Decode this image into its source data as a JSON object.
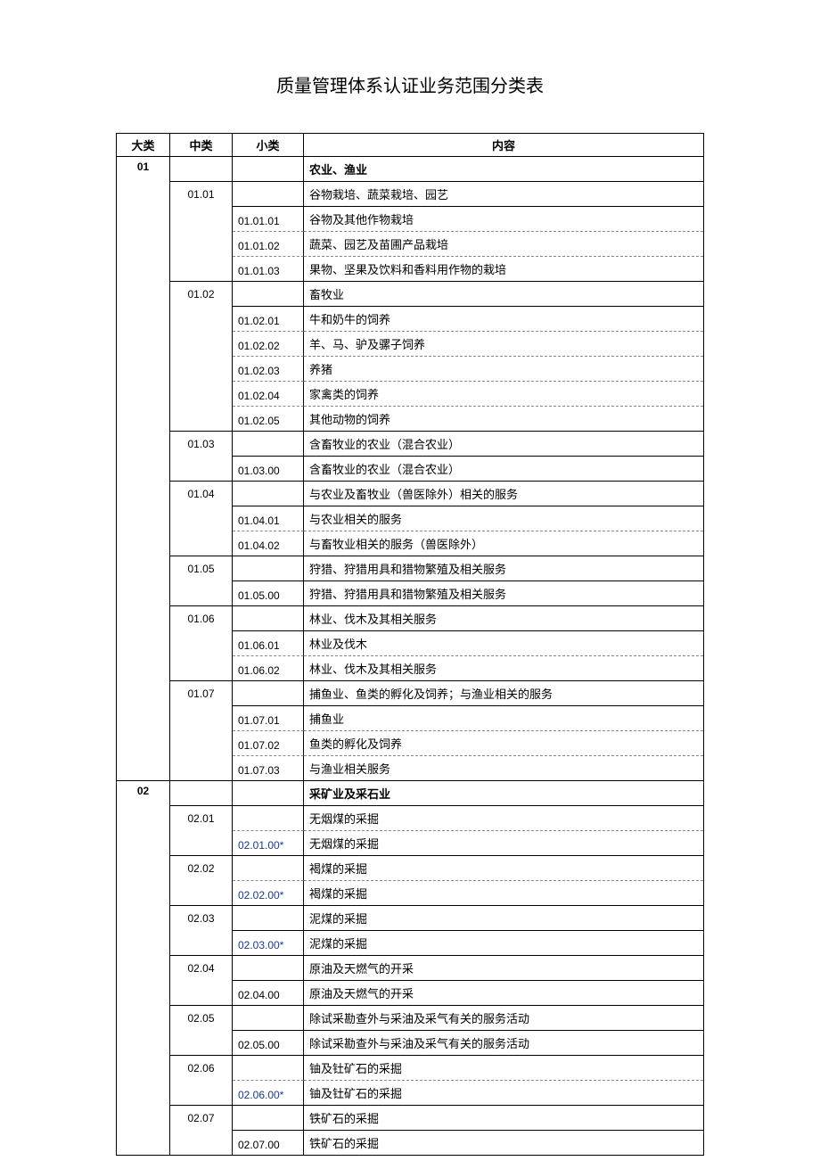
{
  "title": "质量管理体系认证业务范围分类表",
  "headers": {
    "major": "大类",
    "mid": "中类",
    "sub": "小类",
    "content": "内容"
  },
  "rows": [
    {
      "major": "01",
      "mid": "",
      "sub": "",
      "content": "农业、渔业",
      "majorLines": 30,
      "midLines": 1,
      "contentBold": true,
      "bbMajor": "",
      "bbMid": "solid",
      "bbSub": "solid",
      "bbContent": "solid",
      "contentDashAbove": false
    },
    {
      "major": "",
      "mid": "01.01",
      "sub": "",
      "content": "谷物栽培、蔬菜栽培、园艺",
      "midLines": 4,
      "bbMid": "",
      "bbSub": "solid",
      "bbContent": "solid"
    },
    {
      "major": "",
      "mid": "",
      "sub": "01.01.01",
      "content": "谷物及其他作物栽培",
      "bbSub": "dash",
      "bbContent": "dash"
    },
    {
      "major": "",
      "mid": "",
      "sub": "01.01.02",
      "content": "蔬菜、园艺及苗圃产品栽培",
      "bbSub": "dash",
      "bbContent": "dash"
    },
    {
      "major": "",
      "mid": "",
      "sub": "01.01.03",
      "content": "果物、坚果及饮料和香料用作物的栽培",
      "bbMid": "solid",
      "bbSub": "solid",
      "bbContent": "solid",
      "midBottomSolid": true
    },
    {
      "major": "",
      "mid": "01.02",
      "sub": "",
      "content": "畜牧业",
      "midLines": 6,
      "bbMid": "",
      "bbSub": "solid",
      "bbContent": "solid"
    },
    {
      "major": "",
      "mid": "",
      "sub": "01.02.01",
      "content": "牛和奶牛的饲养",
      "bbSub": "dash",
      "bbContent": "dash"
    },
    {
      "major": "",
      "mid": "",
      "sub": "01.02.02",
      "content": "羊、马、驴及骡子饲养",
      "bbSub": "dash",
      "bbContent": "dash"
    },
    {
      "major": "",
      "mid": "",
      "sub": "01.02.03",
      "content": "养猪",
      "bbSub": "dash",
      "bbContent": "dash"
    },
    {
      "major": "",
      "mid": "",
      "sub": "01.02.04",
      "content": "家禽类的饲养",
      "bbSub": "dash",
      "bbContent": "dash"
    },
    {
      "major": "",
      "mid": "",
      "sub": "01.02.05",
      "content": "其他动物的饲养",
      "bbMid": "solid",
      "bbSub": "solid",
      "bbContent": "solid",
      "midBottomSolid": true
    },
    {
      "major": "",
      "mid": "01.03",
      "sub": "",
      "content": "含畜牧业的农业（混合农业）",
      "midLines": 2,
      "bbMid": "",
      "bbSub": "solid",
      "bbContent": "solid"
    },
    {
      "major": "",
      "mid": "",
      "sub": "01.03.00",
      "content": "含畜牧业的农业（混合农业）",
      "bbMid": "solid",
      "bbSub": "solid",
      "bbContent": "solid",
      "midBottomSolid": true
    },
    {
      "major": "",
      "mid": "01.04",
      "sub": "",
      "content": "与农业及畜牧业（兽医除外）相关的服务",
      "midLines": 3,
      "bbMid": "",
      "bbSub": "solid",
      "bbContent": "solid"
    },
    {
      "major": "",
      "mid": "",
      "sub": "01.04.01",
      "content": "与农业相关的服务",
      "bbSub": "dash",
      "bbContent": "dash"
    },
    {
      "major": "",
      "mid": "",
      "sub": "01.04.02",
      "content": "与畜牧业相关的服务（兽医除外）",
      "bbMid": "solid",
      "bbSub": "solid",
      "bbContent": "solid",
      "midBottomSolid": true
    },
    {
      "major": "",
      "mid": "01.05",
      "sub": "",
      "content": "狩猎、狩猎用具和猎物繁殖及相关服务",
      "midLines": 2,
      "bbMid": "",
      "bbSub": "solid",
      "bbContent": "solid"
    },
    {
      "major": "",
      "mid": "",
      "sub": "01.05.00",
      "content": "狩猎、狩猎用具和猎物繁殖及相关服务",
      "bbMid": "solid",
      "bbSub": "solid",
      "bbContent": "solid",
      "midBottomSolid": true
    },
    {
      "major": "",
      "mid": "01.06",
      "sub": "",
      "content": "林业、伐木及其相关服务",
      "midLines": 3,
      "bbMid": "",
      "bbSub": "solid",
      "bbContent": "solid"
    },
    {
      "major": "",
      "mid": "",
      "sub": "01.06.01",
      "content": "林业及伐木",
      "bbSub": "dash",
      "bbContent": "dash"
    },
    {
      "major": "",
      "mid": "",
      "sub": "01.06.02",
      "content": "林业、伐木及其相关服务",
      "bbMid": "solid",
      "bbSub": "solid",
      "bbContent": "solid",
      "midBottomSolid": true
    },
    {
      "major": "",
      "mid": "01.07",
      "sub": "",
      "content": "捕鱼业、鱼类的孵化及饲养；与渔业相关的服务",
      "midLines": 4,
      "bbMid": "",
      "bbSub": "solid",
      "bbContent": "solid"
    },
    {
      "major": "",
      "mid": "",
      "sub": "01.07.01",
      "content": "捕鱼业",
      "bbSub": "dash",
      "bbContent": "dash"
    },
    {
      "major": "",
      "mid": "",
      "sub": "01.07.02",
      "content": "鱼类的孵化及饲养",
      "bbSub": "dash",
      "bbContent": "dash"
    },
    {
      "major": "",
      "mid": "",
      "sub": "01.07.03",
      "content": "与渔业相关服务",
      "bbMid": "solid",
      "bbSub": "solid",
      "bbContent": "solid",
      "midBottomSolid": true,
      "majorBottomSolid": true
    },
    {
      "major": "02",
      "mid": "",
      "sub": "",
      "content": "采矿业及采石业",
      "majorLines": 15,
      "midLines": 1,
      "contentBold": true,
      "bbMid": "solid",
      "bbSub": "solid",
      "bbContent": "solid"
    },
    {
      "major": "",
      "mid": "02.01",
      "sub": "",
      "content": "无烟煤的采掘",
      "midLines": 2,
      "bbMid": "",
      "bbSub": "dash",
      "bbContent": "dash"
    },
    {
      "major": "",
      "mid": "",
      "sub": "02.01.00*",
      "content": "无烟煤的采掘",
      "subStar": true,
      "bbMid": "solid",
      "bbSub": "solid",
      "bbContent": "solid",
      "midBottomSolid": true
    },
    {
      "major": "",
      "mid": "02.02",
      "sub": "",
      "content": "褐煤的采掘",
      "midLines": 2,
      "bbMid": "",
      "bbSub": "dash",
      "bbContent": "dash"
    },
    {
      "major": "",
      "mid": "",
      "sub": "02.02.00*",
      "content": "褐煤的采掘",
      "subStar": true,
      "bbMid": "solid",
      "bbSub": "solid",
      "bbContent": "solid",
      "midBottomSolid": true
    },
    {
      "major": "",
      "mid": "02.03",
      "sub": "",
      "content": "泥煤的采掘",
      "midLines": 2,
      "bbMid": "",
      "bbSub": "solid",
      "bbContent": "solid"
    },
    {
      "major": "",
      "mid": "",
      "sub": "02.03.00*",
      "content": "泥煤的采掘",
      "subStar": true,
      "bbMid": "solid",
      "bbSub": "solid",
      "bbContent": "solid",
      "midBottomSolid": true
    },
    {
      "major": "",
      "mid": "02.04",
      "sub": "",
      "content": "原油及天燃气的开采",
      "midLines": 2,
      "bbMid": "",
      "bbSub": "solid",
      "bbContent": "solid"
    },
    {
      "major": "",
      "mid": "",
      "sub": "02.04.00",
      "content": "原油及天燃气的开采",
      "bbMid": "solid",
      "bbSub": "solid",
      "bbContent": "solid",
      "midBottomSolid": true
    },
    {
      "major": "",
      "mid": "02.05",
      "sub": "",
      "content": "除试采勘查外与采油及采气有关的服务活动",
      "midLines": 2,
      "bbMid": "",
      "bbSub": "solid",
      "bbContent": "solid"
    },
    {
      "major": "",
      "mid": "",
      "sub": "02.05.00",
      "content": "除试采勘查外与采油及采气有关的服务活动",
      "bbMid": "solid",
      "bbSub": "solid",
      "bbContent": "solid",
      "midBottomSolid": true
    },
    {
      "major": "",
      "mid": "02.06",
      "sub": "",
      "content": "铀及钍矿石的采掘",
      "midLines": 2,
      "bbMid": "",
      "bbSub": "dash",
      "bbContent": "dash"
    },
    {
      "major": "",
      "mid": "",
      "sub": "02.06.00*",
      "content": "铀及钍矿石的采掘",
      "subStar": true,
      "bbMid": "solid",
      "bbSub": "solid",
      "bbContent": "solid",
      "midBottomSolid": true
    },
    {
      "major": "",
      "mid": "02.07",
      "sub": "",
      "content": "铁矿石的采掘",
      "midLines": 2,
      "bbMid": "",
      "bbSub": "solid",
      "bbContent": "solid"
    },
    {
      "major": "",
      "mid": "",
      "sub": "02.07.00",
      "content": "铁矿石的采掘",
      "bbMid": "solid",
      "bbSub": "solid",
      "bbContent": "solid",
      "midBottomSolid": true
    }
  ]
}
